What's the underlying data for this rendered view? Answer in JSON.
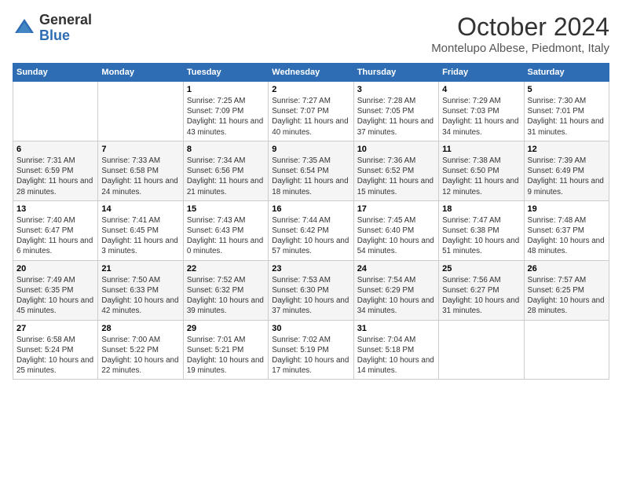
{
  "logo": {
    "general": "General",
    "blue": "Blue"
  },
  "header": {
    "month": "October 2024",
    "location": "Montelupo Albese, Piedmont, Italy"
  },
  "weekdays": [
    "Sunday",
    "Monday",
    "Tuesday",
    "Wednesday",
    "Thursday",
    "Friday",
    "Saturday"
  ],
  "weeks": [
    [
      {
        "day": "",
        "info": ""
      },
      {
        "day": "",
        "info": ""
      },
      {
        "day": "1",
        "info": "Sunrise: 7:25 AM\nSunset: 7:09 PM\nDaylight: 11 hours and 43 minutes."
      },
      {
        "day": "2",
        "info": "Sunrise: 7:27 AM\nSunset: 7:07 PM\nDaylight: 11 hours and 40 minutes."
      },
      {
        "day": "3",
        "info": "Sunrise: 7:28 AM\nSunset: 7:05 PM\nDaylight: 11 hours and 37 minutes."
      },
      {
        "day": "4",
        "info": "Sunrise: 7:29 AM\nSunset: 7:03 PM\nDaylight: 11 hours and 34 minutes."
      },
      {
        "day": "5",
        "info": "Sunrise: 7:30 AM\nSunset: 7:01 PM\nDaylight: 11 hours and 31 minutes."
      }
    ],
    [
      {
        "day": "6",
        "info": "Sunrise: 7:31 AM\nSunset: 6:59 PM\nDaylight: 11 hours and 28 minutes."
      },
      {
        "day": "7",
        "info": "Sunrise: 7:33 AM\nSunset: 6:58 PM\nDaylight: 11 hours and 24 minutes."
      },
      {
        "day": "8",
        "info": "Sunrise: 7:34 AM\nSunset: 6:56 PM\nDaylight: 11 hours and 21 minutes."
      },
      {
        "day": "9",
        "info": "Sunrise: 7:35 AM\nSunset: 6:54 PM\nDaylight: 11 hours and 18 minutes."
      },
      {
        "day": "10",
        "info": "Sunrise: 7:36 AM\nSunset: 6:52 PM\nDaylight: 11 hours and 15 minutes."
      },
      {
        "day": "11",
        "info": "Sunrise: 7:38 AM\nSunset: 6:50 PM\nDaylight: 11 hours and 12 minutes."
      },
      {
        "day": "12",
        "info": "Sunrise: 7:39 AM\nSunset: 6:49 PM\nDaylight: 11 hours and 9 minutes."
      }
    ],
    [
      {
        "day": "13",
        "info": "Sunrise: 7:40 AM\nSunset: 6:47 PM\nDaylight: 11 hours and 6 minutes."
      },
      {
        "day": "14",
        "info": "Sunrise: 7:41 AM\nSunset: 6:45 PM\nDaylight: 11 hours and 3 minutes."
      },
      {
        "day": "15",
        "info": "Sunrise: 7:43 AM\nSunset: 6:43 PM\nDaylight: 11 hours and 0 minutes."
      },
      {
        "day": "16",
        "info": "Sunrise: 7:44 AM\nSunset: 6:42 PM\nDaylight: 10 hours and 57 minutes."
      },
      {
        "day": "17",
        "info": "Sunrise: 7:45 AM\nSunset: 6:40 PM\nDaylight: 10 hours and 54 minutes."
      },
      {
        "day": "18",
        "info": "Sunrise: 7:47 AM\nSunset: 6:38 PM\nDaylight: 10 hours and 51 minutes."
      },
      {
        "day": "19",
        "info": "Sunrise: 7:48 AM\nSunset: 6:37 PM\nDaylight: 10 hours and 48 minutes."
      }
    ],
    [
      {
        "day": "20",
        "info": "Sunrise: 7:49 AM\nSunset: 6:35 PM\nDaylight: 10 hours and 45 minutes."
      },
      {
        "day": "21",
        "info": "Sunrise: 7:50 AM\nSunset: 6:33 PM\nDaylight: 10 hours and 42 minutes."
      },
      {
        "day": "22",
        "info": "Sunrise: 7:52 AM\nSunset: 6:32 PM\nDaylight: 10 hours and 39 minutes."
      },
      {
        "day": "23",
        "info": "Sunrise: 7:53 AM\nSunset: 6:30 PM\nDaylight: 10 hours and 37 minutes."
      },
      {
        "day": "24",
        "info": "Sunrise: 7:54 AM\nSunset: 6:29 PM\nDaylight: 10 hours and 34 minutes."
      },
      {
        "day": "25",
        "info": "Sunrise: 7:56 AM\nSunset: 6:27 PM\nDaylight: 10 hours and 31 minutes."
      },
      {
        "day": "26",
        "info": "Sunrise: 7:57 AM\nSunset: 6:25 PM\nDaylight: 10 hours and 28 minutes."
      }
    ],
    [
      {
        "day": "27",
        "info": "Sunrise: 6:58 AM\nSunset: 5:24 PM\nDaylight: 10 hours and 25 minutes."
      },
      {
        "day": "28",
        "info": "Sunrise: 7:00 AM\nSunset: 5:22 PM\nDaylight: 10 hours and 22 minutes."
      },
      {
        "day": "29",
        "info": "Sunrise: 7:01 AM\nSunset: 5:21 PM\nDaylight: 10 hours and 19 minutes."
      },
      {
        "day": "30",
        "info": "Sunrise: 7:02 AM\nSunset: 5:19 PM\nDaylight: 10 hours and 17 minutes."
      },
      {
        "day": "31",
        "info": "Sunrise: 7:04 AM\nSunset: 5:18 PM\nDaylight: 10 hours and 14 minutes."
      },
      {
        "day": "",
        "info": ""
      },
      {
        "day": "",
        "info": ""
      }
    ]
  ]
}
